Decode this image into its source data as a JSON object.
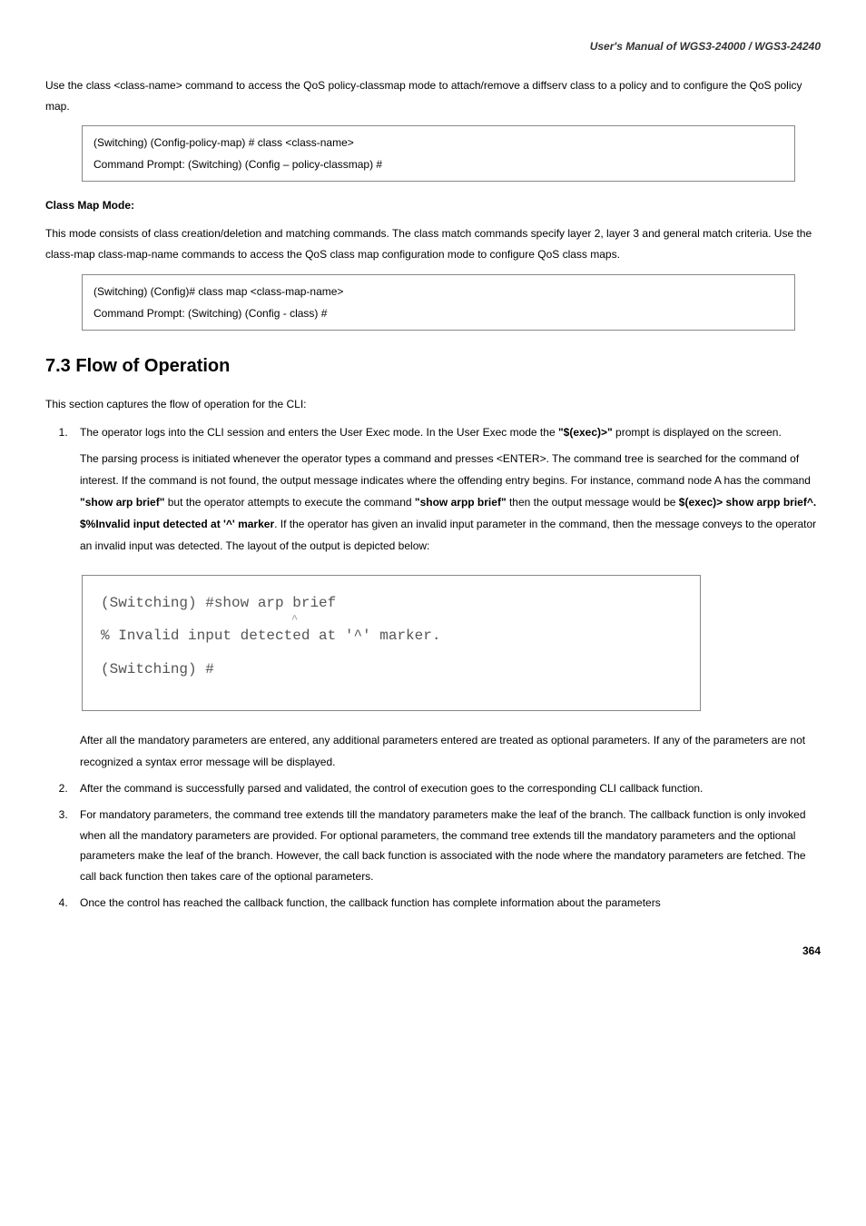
{
  "header": "User's  Manual  of  WGS3-24000  /  WGS3-24240",
  "intro_para": "Use the class <class-name> command to access the QoS policy-classmap mode to attach/remove a diffserv class to a policy and to configure the QoS policy map.",
  "code_box_1": {
    "line1": "(Switching) (Config-policy-map) # class <class-name>",
    "line2": "Command Prompt: (Switching) (Config – policy-classmap) #"
  },
  "class_map_label": "Class Map Mode:",
  "class_map_para": "This mode consists of class creation/deletion and matching commands. The class match commands specify layer 2, layer 3 and general match criteria. Use the class-map class-map-name commands to access the QoS class map configuration mode to configure QoS class maps.",
  "code_box_2": {
    "line1": "(Switching) (Config)# class map <class-map-name>",
    "line2": "Command Prompt: (Switching) (Config - class) #"
  },
  "section_heading": "7.3 Flow of Operation",
  "section_intro": "This section captures the flow of operation for the CLI:",
  "list": {
    "item1": {
      "lead": "The operator logs into the CLI session and enters the User Exec mode. In the User Exec mode the ",
      "bold1": "\"$(exec)>\"",
      "tail1": " prompt is displayed on the screen.",
      "para2a": "The parsing process is initiated whenever the operator types a command and presses <ENTER>. The command tree is searched for the command of interest. If the command is not found, the output message indicates where the offending entry begins. For instance, command node A has the command ",
      "bold2": "\"show arp brief\"",
      "para2b": " but the operator attempts to execute the command ",
      "bold3": "\"show arpp brief\"",
      "para2c": " then the output message would be ",
      "bold4": "$(exec)> show arpp brief^. $%Invalid input detected at '^' marker",
      "para2d": ". If the operator has given an invalid input parameter in the command, then the message conveys to the operator an invalid input was detected. The layout of the output is depicted below:",
      "after_image": "After all the mandatory parameters are entered, any additional parameters entered are treated as optional parameters. If any of the parameters are not recognized a syntax error message will be displayed."
    },
    "item2": "After the command is successfully parsed and validated, the control of execution goes to the corresponding CLI callback function.",
    "item3": "For mandatory parameters, the command tree extends till the mandatory parameters make the leaf of the branch. The callback function is only invoked when all the mandatory parameters are provided. For optional parameters, the command tree extends till the mandatory parameters and the optional parameters make the leaf of the branch. However, the call back function is associated with the node where the mandatory parameters are fetched. The call back function then takes care of the optional parameters.",
    "item4": "Once the control has reached the callback function, the callback function has complete information about the parameters"
  },
  "terminal": {
    "line1": "(Switching) #show arp brief",
    "caret": "^",
    "line2": "% Invalid input detected at '^' marker.",
    "line3": "(Switching) #"
  },
  "page_number": "364"
}
